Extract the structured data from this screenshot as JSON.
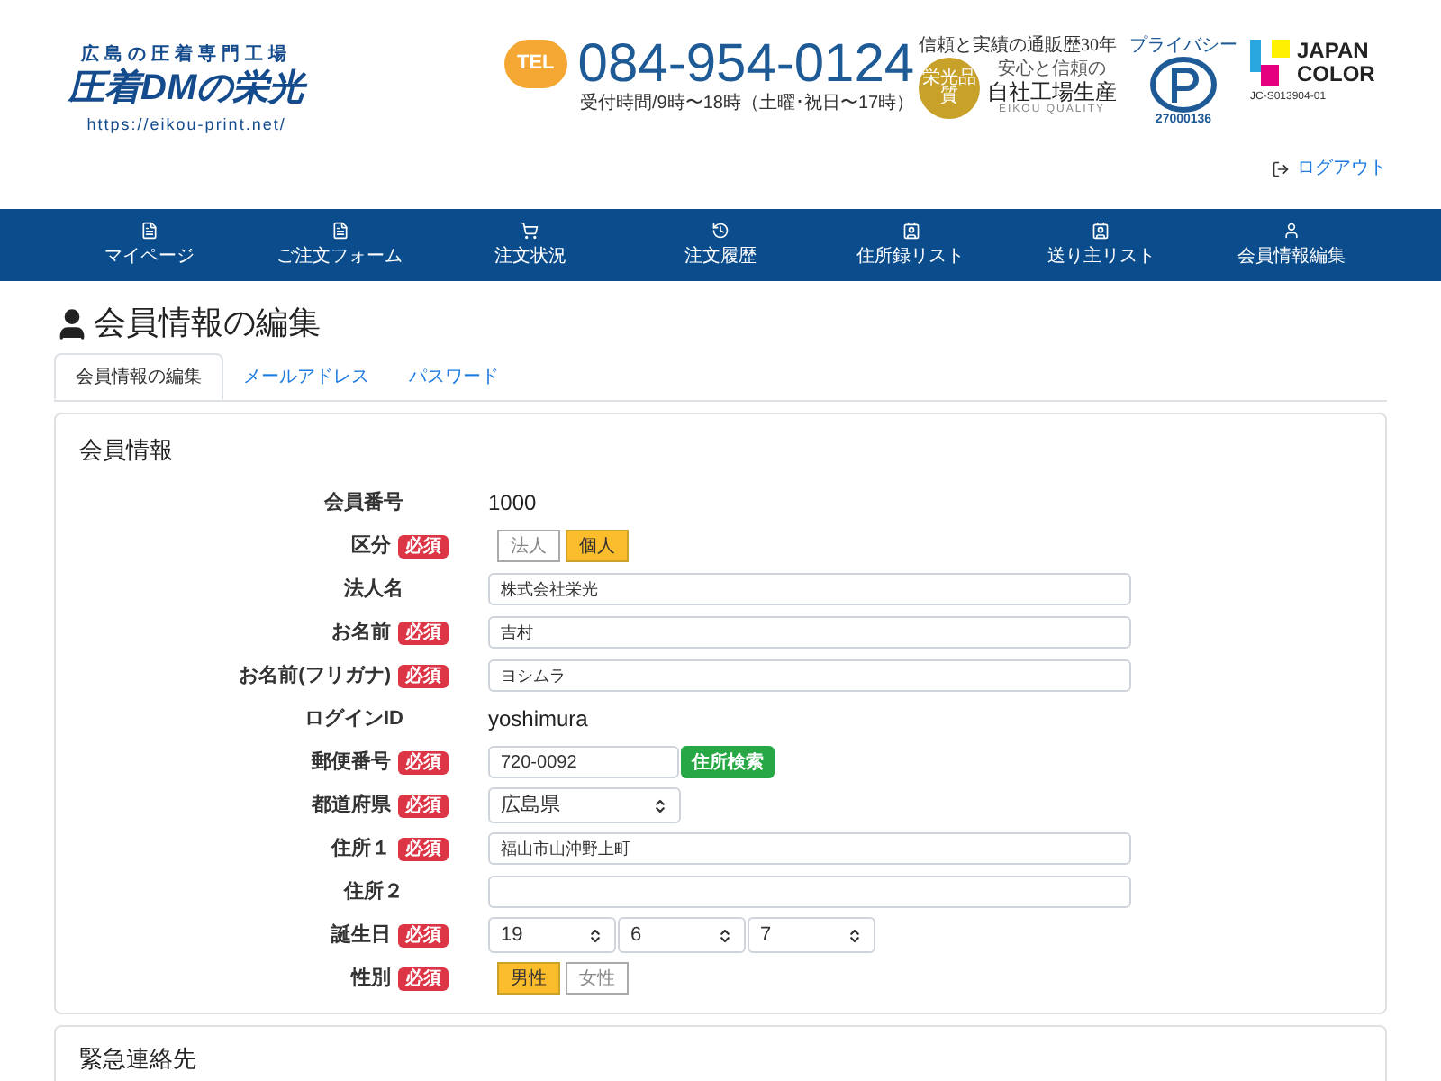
{
  "header": {
    "tagline": "広島の圧着専門工場",
    "brand": "圧着DMの栄光",
    "url": "https://eikou-print.net/",
    "tel_badge": "TEL",
    "phone": "084-954-0124",
    "hours": "受付時間/9時〜18時（土曜･祝日〜17時）",
    "quality": {
      "headline": "信頼と実績の通販歴30年",
      "seal": "栄光品質",
      "sub": "安心と信頼の",
      "main": "自社工場生産",
      "caption": "EIKOU QUALITY"
    },
    "privacy": {
      "label": "プライバシー",
      "number": "27000136"
    },
    "japan_color": {
      "line1": "JAPAN",
      "line2": "COLOR",
      "code": "JC-S013904-01"
    },
    "logout": "ログアウト"
  },
  "nav": [
    {
      "label": "マイページ"
    },
    {
      "label": "ご注文フォーム"
    },
    {
      "label": "注文状況"
    },
    {
      "label": "注文履歴"
    },
    {
      "label": "住所録リスト"
    },
    {
      "label": "送り主リスト"
    },
    {
      "label": "会員情報編集"
    }
  ],
  "page_title": "会員情報の編集",
  "tabs": [
    {
      "label": "会員情報の編集",
      "selected": true
    },
    {
      "label": "メールアドレス",
      "selected": false
    },
    {
      "label": "パスワード",
      "selected": false
    }
  ],
  "section": {
    "title": "会員情報",
    "rows": [
      {
        "kind": "text",
        "label": "会員番号",
        "value": "1000"
      },
      {
        "kind": "toggle",
        "label": "区分",
        "badge": "必須",
        "options": [
          {
            "label": "法人",
            "selected": false
          },
          {
            "label": "個人",
            "selected": true
          }
        ]
      },
      {
        "kind": "input",
        "label": "法人名",
        "value": "株式会社栄光"
      },
      {
        "kind": "input",
        "label": "お名前",
        "badge": "必須",
        "value": "吉村"
      },
      {
        "kind": "input",
        "label": "お名前(フリガナ)",
        "badge": "必須",
        "value": "ヨシムラ"
      },
      {
        "kind": "text",
        "label": "ログインID",
        "value": "yoshimura"
      },
      {
        "kind": "zip",
        "label": "郵便番号",
        "badge": "必須",
        "value": "720-0092",
        "button": "住所検索"
      },
      {
        "kind": "select",
        "label": "都道府県",
        "badge": "必須",
        "values": [
          "広島県"
        ]
      },
      {
        "kind": "input",
        "label": "住所１",
        "badge": "必須",
        "value": "福山市山沖野上町"
      },
      {
        "kind": "input",
        "label": "住所２"
      },
      {
        "kind": "select",
        "label": "誕生日",
        "badge": "必須",
        "values": [
          "19",
          "6",
          "7"
        ]
      },
      {
        "kind": "toggle",
        "label": "性別",
        "badge": "必須",
        "options": [
          {
            "label": "男性",
            "selected": true
          },
          {
            "label": "女性",
            "selected": false
          }
        ]
      }
    ]
  },
  "next_section": {
    "title": "緊急連絡先"
  }
}
